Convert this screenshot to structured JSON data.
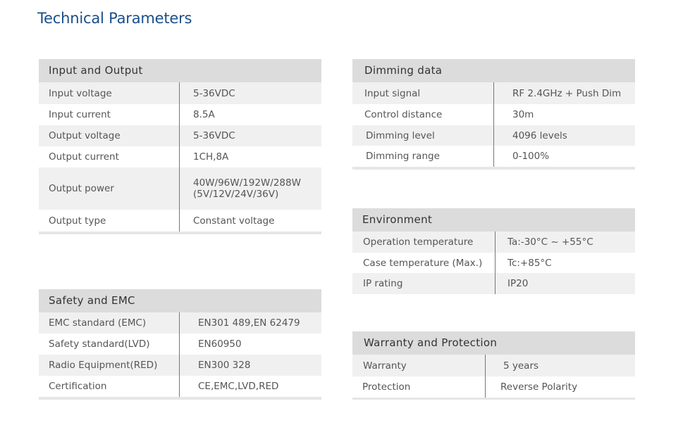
{
  "title": "Technical Parameters",
  "tables": {
    "input_output": {
      "heading": "Input and Output",
      "rows": [
        {
          "label": "Input voltage",
          "value": "5-36VDC"
        },
        {
          "label": "Input current",
          "value": "8.5A"
        },
        {
          "label": "Output voltage",
          "value": "5-36VDC"
        },
        {
          "label": "Output current",
          "value": "1CH,8A"
        },
        {
          "label": "Output power",
          "value": "40W/96W/192W/288W",
          "value2": "(5V/12V/24V/36V)"
        },
        {
          "label": "Output type",
          "value": "Constant voltage"
        }
      ]
    },
    "safety_emc": {
      "heading": "Safety and EMC",
      "rows": [
        {
          "label": "EMC standard (EMC)",
          "value": "EN301 489,EN 62479"
        },
        {
          "label": "Safety standard(LVD)",
          "value": "EN60950"
        },
        {
          "label": "Radio Equipment(RED)",
          "value": "EN300 328"
        },
        {
          "label": "Certification",
          "value": "CE,EMC,LVD,RED"
        }
      ]
    },
    "dimming": {
      "heading": "Dimming data",
      "rows": [
        {
          "label": "Input signal",
          "value": "RF 2.4GHz + Push Dim"
        },
        {
          "label": "Control distance",
          "value": "30m"
        },
        {
          "label": "Dimming level",
          "value": "4096 levels"
        },
        {
          "label": "Dimming range",
          "value": "0-100%"
        }
      ]
    },
    "environment": {
      "heading": "Environment",
      "rows": [
        {
          "label": "Operation temperature",
          "value": "Ta:-30°C ~ +55°C"
        },
        {
          "label": "Case temperature (Max.)",
          "value": "Tc:+85°C"
        },
        {
          "label": "IP rating",
          "value": "IP20"
        }
      ]
    },
    "warranty": {
      "heading": "Warranty and Protection",
      "rows": [
        {
          "label": "Warranty",
          "value": "5 years"
        },
        {
          "label": "Protection",
          "value": "Reverse Polarity"
        }
      ]
    }
  }
}
